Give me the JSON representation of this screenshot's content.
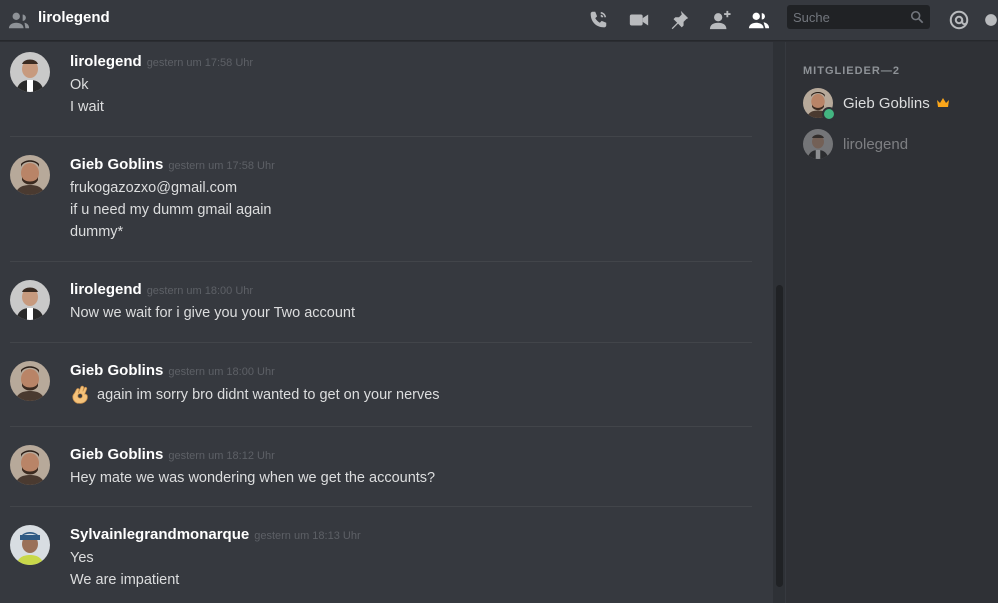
{
  "header": {
    "title": "lirolegend",
    "icons": [
      "user-icon",
      "phone-call-icon",
      "video-icon",
      "pin-icon",
      "add-friend-icon",
      "members-icon",
      "search-icon",
      "mention-icon",
      "help-icon"
    ],
    "search_placeholder": "Suche"
  },
  "messages": [
    {
      "author": "lirolegend",
      "time": "gestern um 17:58 Uhr",
      "lines": [
        "Ok",
        "I wait"
      ]
    },
    {
      "author": "Gieb Goblins",
      "time": "gestern um 17:58 Uhr",
      "lines": [
        "frukogazozxo@gmail.com",
        "if u need my dumm gmail again",
        "dummy*"
      ]
    },
    {
      "author": "lirolegend",
      "time": "gestern um 18:00 Uhr",
      "lines": [
        "Now we wait for i give you your Two account"
      ]
    },
    {
      "author": "Gieb Goblins",
      "time": "gestern um 18:00 Uhr",
      "lines": [
        "again im sorry bro didnt wanted to get on your nerves"
      ],
      "emoji": "ok-hand-emoji"
    },
    {
      "author": "Gieb Goblins",
      "time": "gestern um 18:12 Uhr",
      "lines": [
        "Hey mate we was wondering when we get the accounts?"
      ]
    },
    {
      "author": "Sylvainlegrandmonarque",
      "time": "gestern um 18:13 Uhr",
      "lines": [
        "Yes",
        "We are impatient"
      ]
    }
  ],
  "members": {
    "header": "MITGLIEDER—2",
    "list": [
      {
        "name": "Gieb Goblins",
        "status": "online",
        "owner": true
      },
      {
        "name": "lirolegend",
        "status": "offline",
        "owner": false
      }
    ]
  },
  "colors": {
    "background": "#36393f",
    "sidebar": "#2f3136",
    "online": "#43b581",
    "crown": "#faa61a"
  }
}
